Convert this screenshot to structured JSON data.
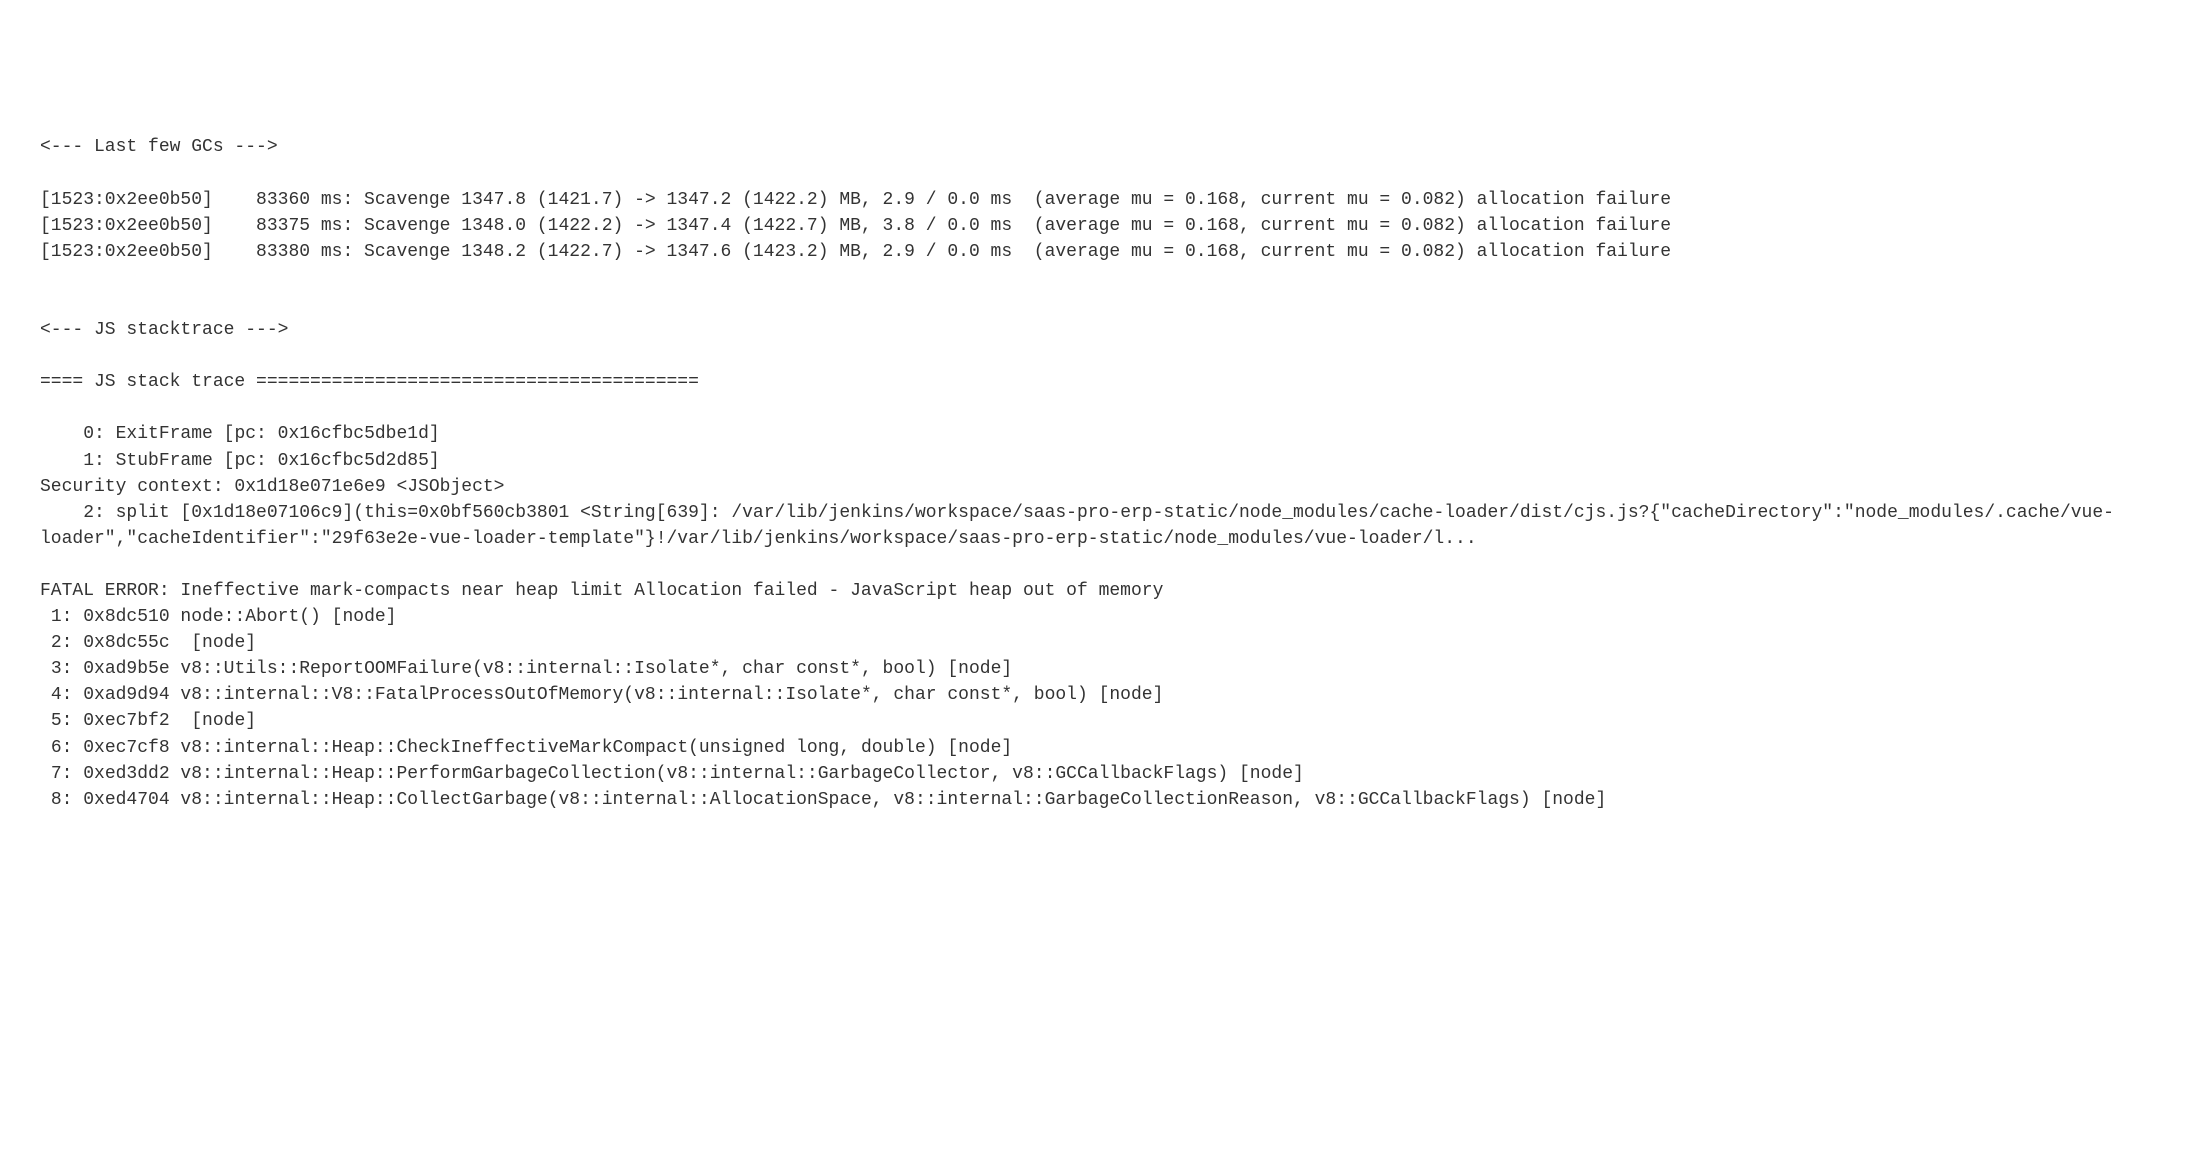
{
  "log": {
    "gc_header": "<--- Last few GCs --->",
    "gc_lines": [
      "[1523:0x2ee0b50]    83360 ms: Scavenge 1347.8 (1421.7) -> 1347.2 (1422.2) MB, 2.9 / 0.0 ms  (average mu = 0.168, current mu = 0.082) allocation failure",
      "[1523:0x2ee0b50]    83375 ms: Scavenge 1348.0 (1422.2) -> 1347.4 (1422.7) MB, 3.8 / 0.0 ms  (average mu = 0.168, current mu = 0.082) allocation failure",
      "[1523:0x2ee0b50]    83380 ms: Scavenge 1348.2 (1422.7) -> 1347.6 (1423.2) MB, 2.9 / 0.0 ms  (average mu = 0.168, current mu = 0.082) allocation failure"
    ],
    "stacktrace_header": "<--- JS stacktrace --->",
    "stack_trace_divider": "==== JS stack trace =========================================",
    "stack_frames": [
      "    0: ExitFrame [pc: 0x16cfbc5dbe1d]",
      "    1: StubFrame [pc: 0x16cfbc5d2d85]",
      "Security context: 0x1d18e071e6e9 <JSObject>",
      "    2: split [0x1d18e07106c9](this=0x0bf560cb3801 <String[639]: /var/lib/jenkins/workspace/saas-pro-erp-static/node_modules/cache-loader/dist/cjs.js?{\"cacheDirectory\":\"node_modules/.cache/vue-loader\",\"cacheIdentifier\":\"29f63e2e-vue-loader-template\"}!/var/lib/jenkins/workspace/saas-pro-erp-static/node_modules/vue-loader/l..."
    ],
    "fatal_error": "FATAL ERROR: Ineffective mark-compacts near heap limit Allocation failed - JavaScript heap out of memory",
    "native_stack": [
      " 1: 0x8dc510 node::Abort() [node]",
      " 2: 0x8dc55c  [node]",
      " 3: 0xad9b5e v8::Utils::ReportOOMFailure(v8::internal::Isolate*, char const*, bool) [node]",
      " 4: 0xad9d94 v8::internal::V8::FatalProcessOutOfMemory(v8::internal::Isolate*, char const*, bool) [node]",
      " 5: 0xec7bf2  [node]",
      " 6: 0xec7cf8 v8::internal::Heap::CheckIneffectiveMarkCompact(unsigned long, double) [node]",
      " 7: 0xed3dd2 v8::internal::Heap::PerformGarbageCollection(v8::internal::GarbageCollector, v8::GCCallbackFlags) [node]",
      " 8: 0xed4704 v8::internal::Heap::CollectGarbage(v8::internal::AllocationSpace, v8::internal::GarbageCollectionReason, v8::GCCallbackFlags) [node]"
    ]
  }
}
